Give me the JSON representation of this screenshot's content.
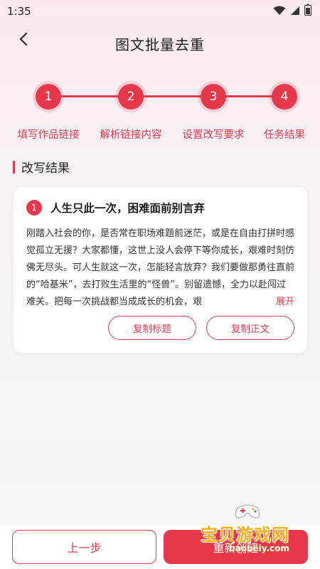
{
  "status_bar": {
    "time": "1:35"
  },
  "header": {
    "title": "图文批量去重"
  },
  "steps": [
    {
      "num": "1",
      "label": "填写作品链接"
    },
    {
      "num": "2",
      "label": "解析链接内容"
    },
    {
      "num": "3",
      "label": "设置改写要求"
    },
    {
      "num": "4",
      "label": "任务结果"
    }
  ],
  "section": {
    "title": "改写结果"
  },
  "card": {
    "num": "1",
    "title": "人生只此一次，困难面前别言弃",
    "body": "刚踏入社会的你，是否常在职场难题前迷茫，或是在自由打拼时感觉孤立无援？大家都懂，这世上没人会停下等你成长，艰难时刻仿佛无尽头。可人生就这一次，怎能轻言放弃？我们要做那勇往直前的“哈基米”，去打败生活里的“怪兽”。别留遗憾，全力以赴闯过难关。把每一次挑战都当成成长的机会，艰",
    "expand_label": "展开",
    "copy_title_label": "复制标题",
    "copy_body_label": "复制正文"
  },
  "bottom": {
    "prev_label": "上一步",
    "next_label": "重新创建"
  },
  "watermark": {
    "text": "宝贝游戏网",
    "url": "baobeiy.com"
  },
  "colors": {
    "accent": "#e7384b",
    "background": "#f7f3f7"
  },
  "icons": [
    "wifi-icon",
    "signal-icon",
    "battery-icon",
    "back-arrow-icon"
  ]
}
